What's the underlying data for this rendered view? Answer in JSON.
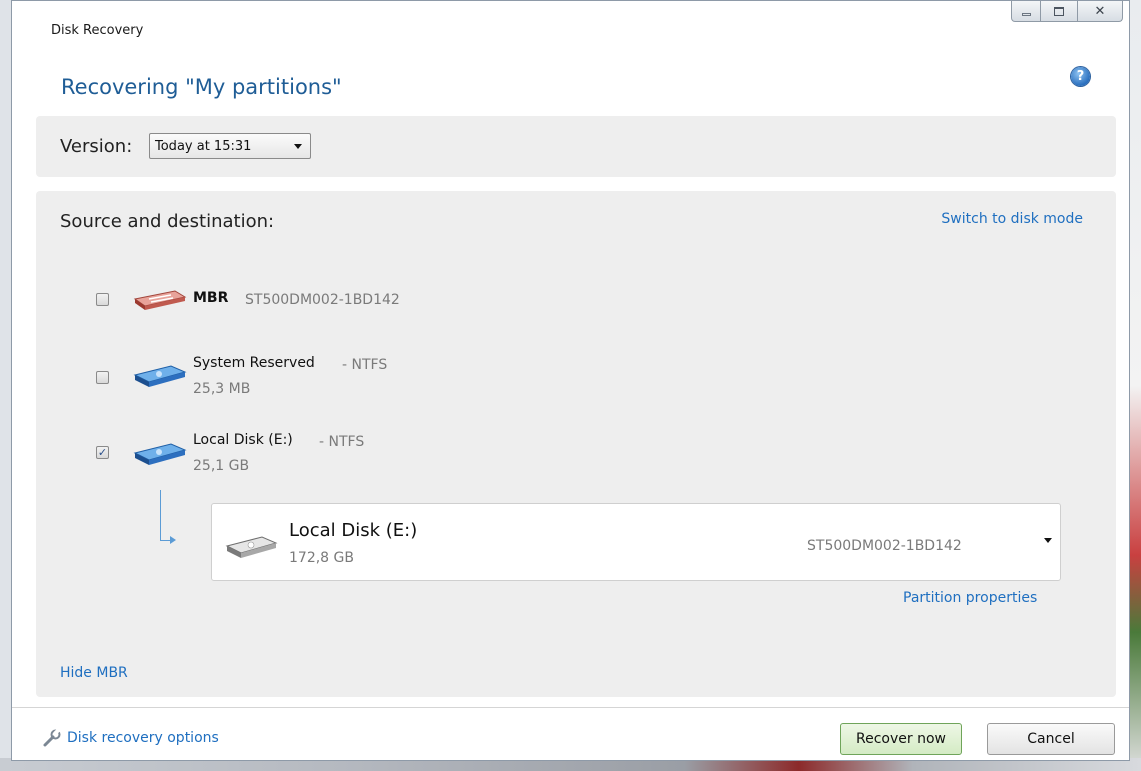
{
  "window": {
    "title": "Disk Recovery",
    "controls": [
      "minimize-icon",
      "maximize-icon",
      "close-icon"
    ]
  },
  "header": {
    "heading": "Recovering \"My partitions\"",
    "help_icon": "question-mark-icon"
  },
  "version": {
    "label": "Version:",
    "selected": "Today at 15:31"
  },
  "source": {
    "title": "Source and destination:",
    "switch_link": "Switch to disk mode",
    "items": [
      {
        "name": "MBR",
        "detail": "ST500DM002-1BD142",
        "size": "",
        "checked": false,
        "icon": "mbr-disk-icon"
      },
      {
        "name": "System Reserved",
        "detail": "- NTFS",
        "size": "25,3 MB",
        "checked": false,
        "icon": "partition-disk-icon"
      },
      {
        "name": "Local Disk (E:)",
        "detail": "- NTFS",
        "size": "25,1 GB",
        "checked": true,
        "icon": "partition-disk-icon"
      }
    ],
    "destination": {
      "name": "Local Disk (E:)",
      "size": "172,8 GB",
      "model": "ST500DM002-1BD142",
      "icon": "hard-disk-icon"
    },
    "partition_properties_link": "Partition properties",
    "hide_mbr_link": "Hide MBR"
  },
  "footer": {
    "options_link": "Disk recovery options",
    "options_icon": "wrench-icon",
    "recover_button": "Recover now",
    "cancel_button": "Cancel"
  },
  "colors": {
    "accent_link": "#1f6fc0",
    "heading": "#1f5d96",
    "panel_bg": "#eeeeee",
    "recover_button_bg": "#d4ebc4"
  }
}
